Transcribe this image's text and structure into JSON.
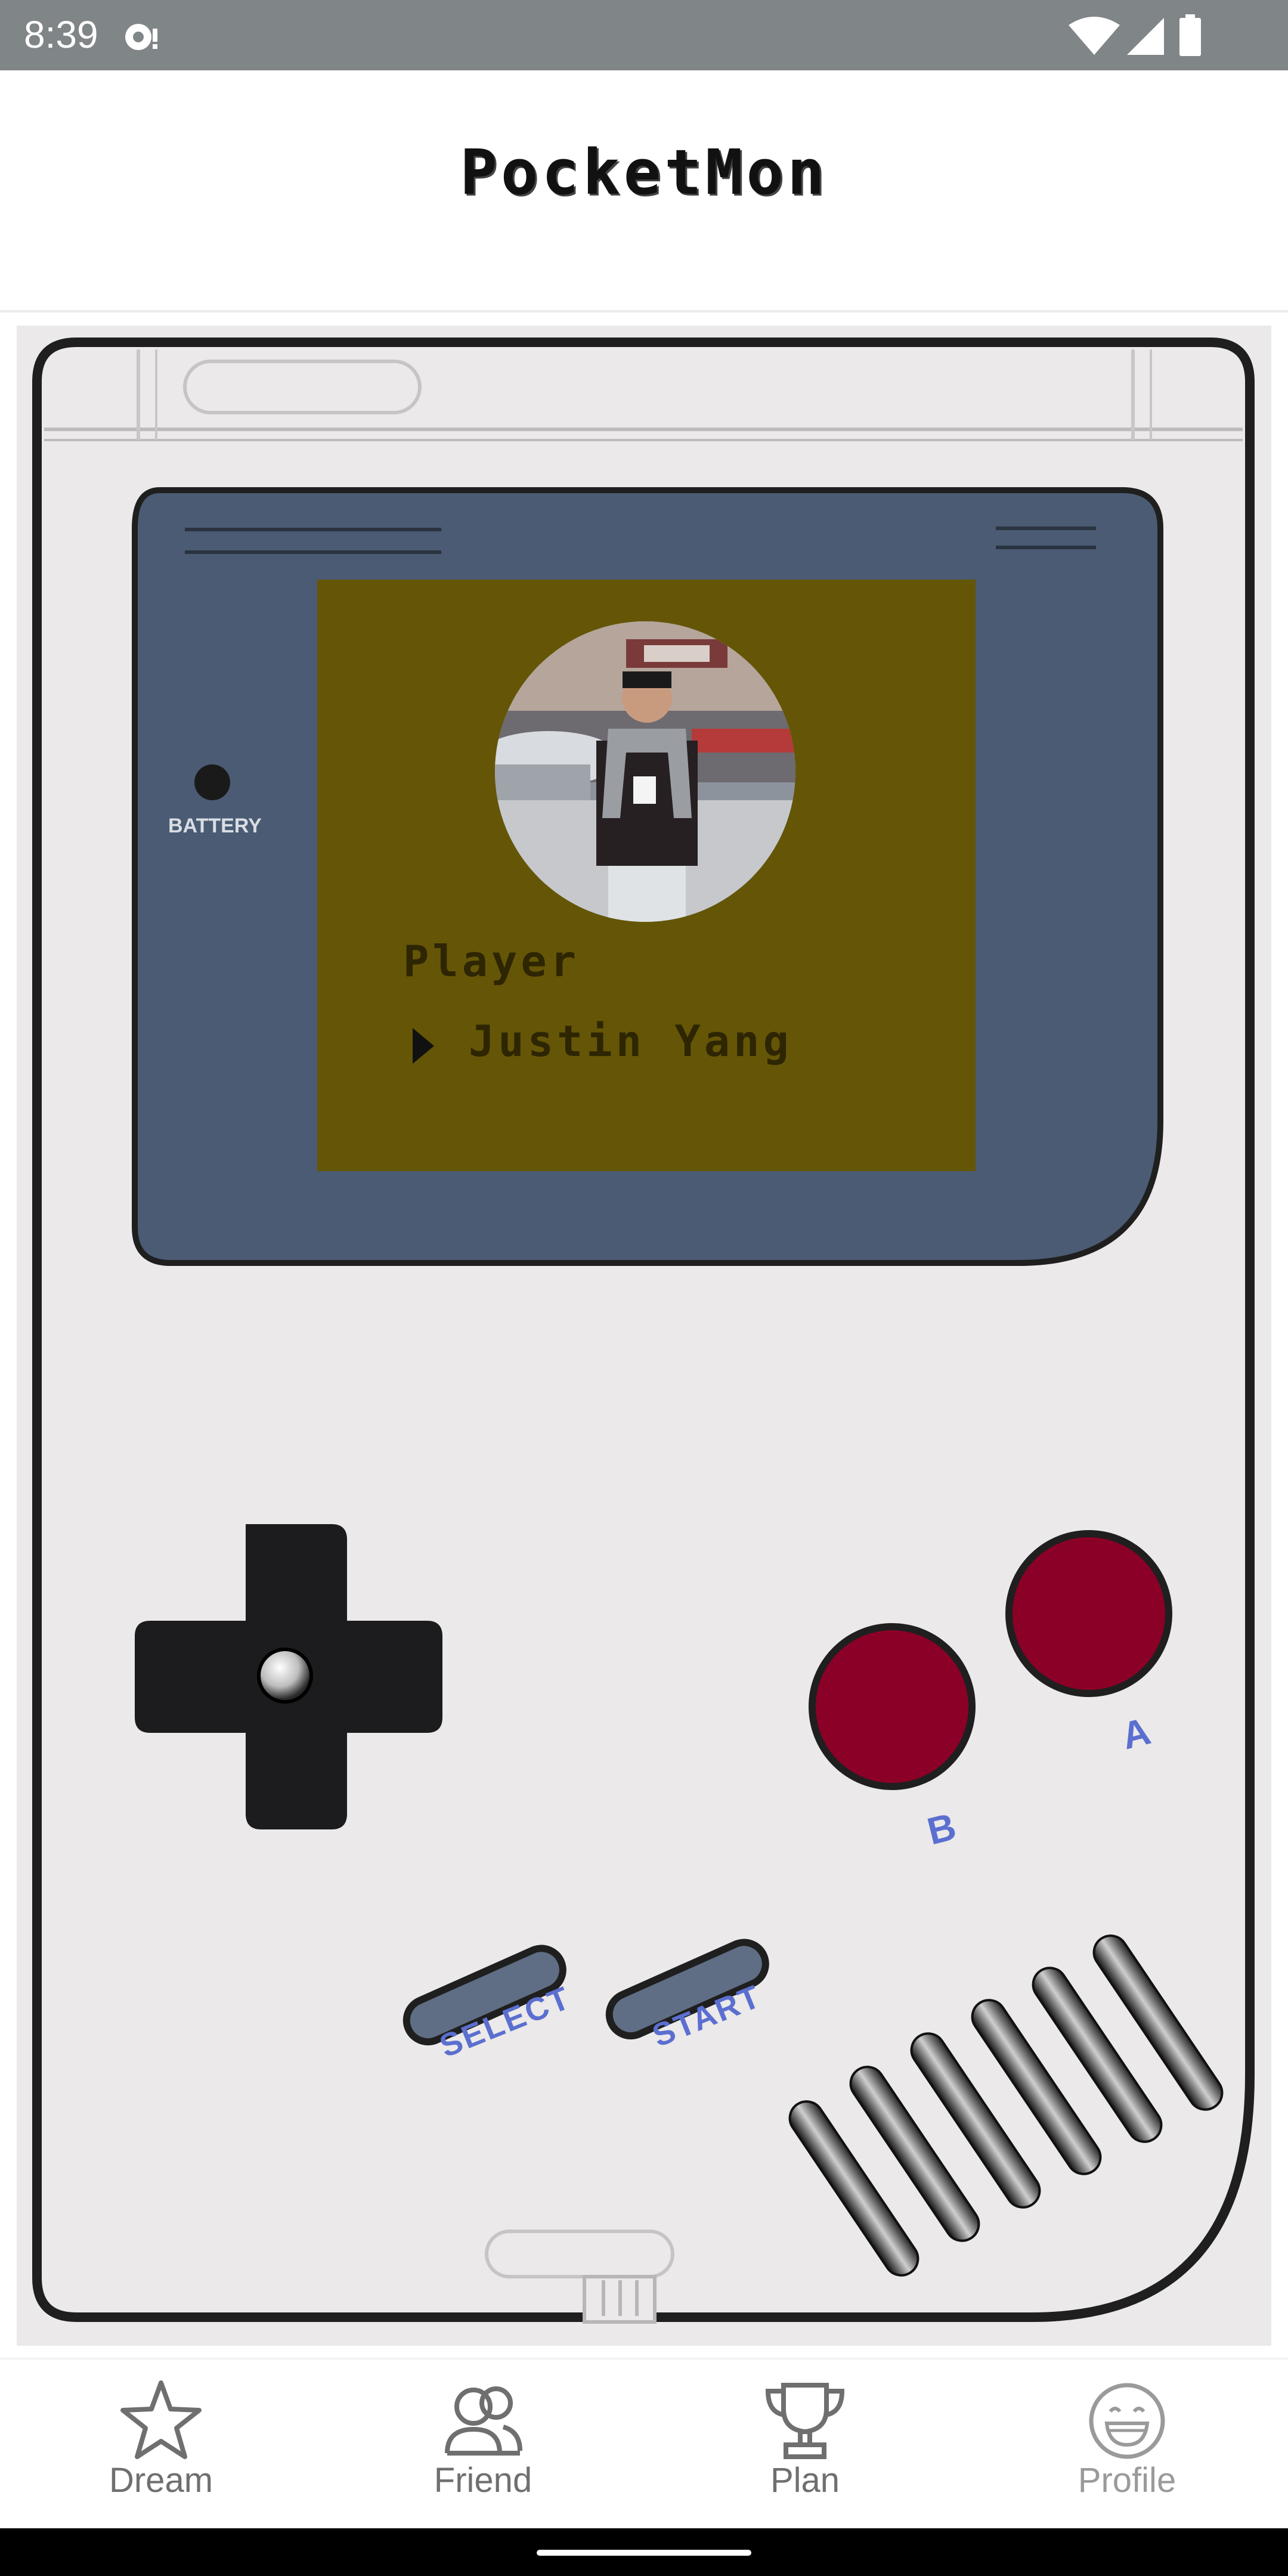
{
  "status_bar": {
    "time": "8:39",
    "icons": [
      "notification-icon",
      "wifi-icon",
      "cellular-signal-icon",
      "battery-icon"
    ],
    "background": "#808587"
  },
  "app_bar": {
    "title": "PocketMon"
  },
  "gameboy": {
    "body_color": "#ebe9e9",
    "screen_frame_color": "#4a5b73",
    "screen_color": "#645606",
    "button_color": "#8b0027",
    "battery_label": "BATTERY",
    "button_a_label": "A",
    "button_b_label": "B",
    "select_label": "SELECT",
    "start_label": "START",
    "screen": {
      "avatar_alt": "profile-photo",
      "player_label": "Player",
      "player_name": "Justin Yang"
    }
  },
  "bottom_nav": {
    "items": [
      {
        "label": "Dream",
        "icon": "star-icon"
      },
      {
        "label": "Friend",
        "icon": "friends-icon"
      },
      {
        "label": "Plan",
        "icon": "trophy-icon"
      },
      {
        "label": "Profile",
        "icon": "smiley-icon"
      }
    ]
  }
}
